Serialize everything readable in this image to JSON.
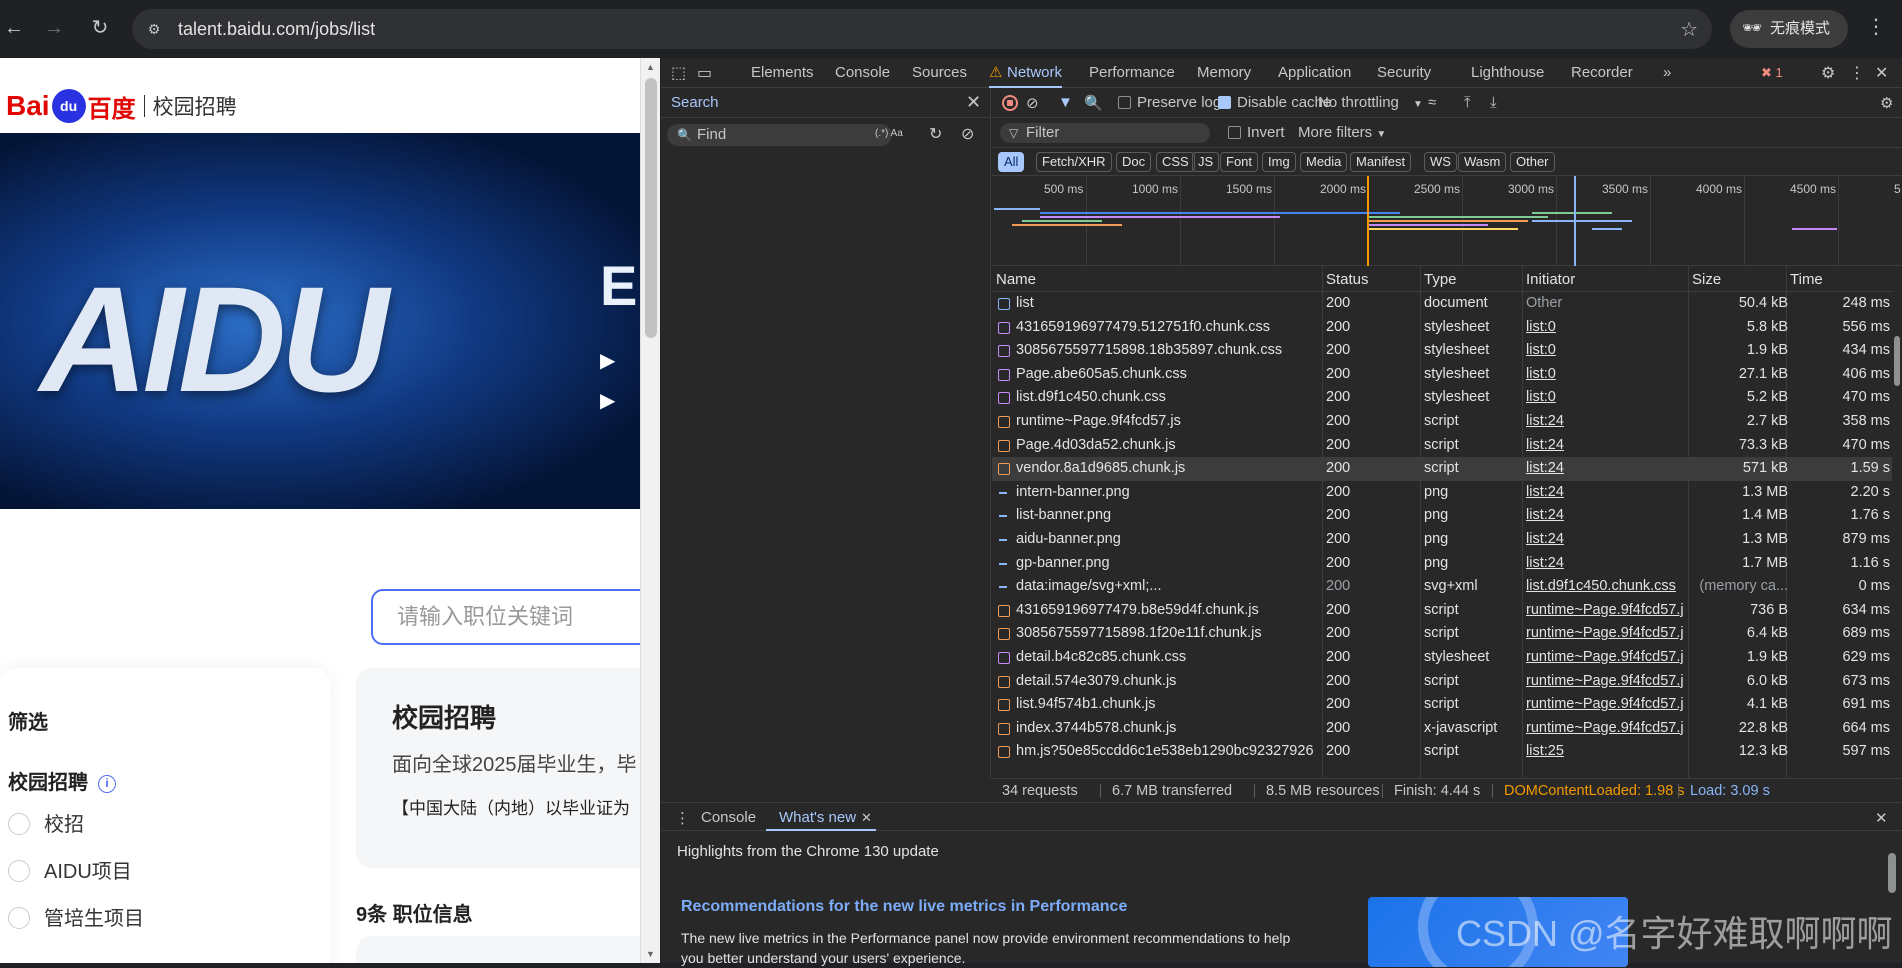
{
  "browser": {
    "url": "talent.baidu.com/jobs/list",
    "incognito_label": "无痕模式"
  },
  "page": {
    "logo": {
      "bai": "Bai",
      "du": "du",
      "cn": "百度",
      "sub": "校园招聘"
    },
    "banner": {
      "text": "AIDU",
      "side": "E"
    },
    "search_placeholder": "请输入职位关键词",
    "filter": {
      "title": "筛选",
      "section": "校园招聘",
      "options": [
        "校招",
        "AIDU项目",
        "管培生项目"
      ]
    },
    "main": {
      "title": "校园招聘",
      "desc": "面向全球2025届毕业生，毕",
      "note": "【中国大陆（内地）以毕业证为"
    },
    "count": "9条 职位信息"
  },
  "devtools": {
    "tabs": [
      "Elements",
      "Console",
      "Sources",
      "Network",
      "Performance",
      "Memory",
      "Application",
      "Security",
      "Lighthouse",
      "Recorder"
    ],
    "active_tab": "Network",
    "error_count": "1",
    "search": {
      "label": "Search",
      "find_placeholder": "Find",
      "opts": "(.*)  Aa"
    },
    "toolbar": {
      "preserve_log": "Preserve log",
      "disable_cache": "Disable cache",
      "throttling": "No throttling"
    },
    "filter": {
      "placeholder": "Filter",
      "invert": "Invert",
      "more_filters": "More filters"
    },
    "type_filters": [
      "All",
      "Fetch/XHR",
      "Doc",
      "CSS",
      "JS",
      "Font",
      "Img",
      "Media",
      "Manifest",
      "WS",
      "Wasm",
      "Other"
    ],
    "timeline_ticks": [
      "500 ms",
      "1000 ms",
      "1500 ms",
      "2000 ms",
      "2500 ms",
      "3000 ms",
      "3500 ms",
      "4000 ms",
      "4500 ms",
      "5"
    ],
    "columns": [
      "Name",
      "Status",
      "Type",
      "Initiator",
      "Size",
      "Time"
    ],
    "requests": [
      {
        "name": "list",
        "status": "200",
        "type": "document",
        "initiator": "Other",
        "size": "50.4 kB",
        "time": "248 ms",
        "kind": "doc"
      },
      {
        "name": "431659196977479.512751f0.chunk.css",
        "status": "200",
        "type": "stylesheet",
        "initiator": "list:0",
        "size": "5.8 kB",
        "time": "556 ms",
        "kind": "css"
      },
      {
        "name": "3085675597715898.18b35897.chunk.css",
        "status": "200",
        "type": "stylesheet",
        "initiator": "list:0",
        "size": "1.9 kB",
        "time": "434 ms",
        "kind": "css"
      },
      {
        "name": "Page.abe605a5.chunk.css",
        "status": "200",
        "type": "stylesheet",
        "initiator": "list:0",
        "size": "27.1 kB",
        "time": "406 ms",
        "kind": "css"
      },
      {
        "name": "list.d9f1c450.chunk.css",
        "status": "200",
        "type": "stylesheet",
        "initiator": "list:0",
        "size": "5.2 kB",
        "time": "470 ms",
        "kind": "css"
      },
      {
        "name": "runtime~Page.9f4fcd57.js",
        "status": "200",
        "type": "script",
        "initiator": "list:24",
        "size": "2.7 kB",
        "time": "358 ms",
        "kind": "js"
      },
      {
        "name": "Page.4d03da52.chunk.js",
        "status": "200",
        "type": "script",
        "initiator": "list:24",
        "size": "73.3 kB",
        "time": "470 ms",
        "kind": "js"
      },
      {
        "name": "vendor.8a1d9685.chunk.js",
        "status": "200",
        "type": "script",
        "initiator": "list:24",
        "size": "571 kB",
        "time": "1.59 s",
        "kind": "js"
      },
      {
        "name": "intern-banner.png",
        "status": "200",
        "type": "png",
        "initiator": "list:24",
        "size": "1.3 MB",
        "time": "2.20 s",
        "kind": "img"
      },
      {
        "name": "list-banner.png",
        "status": "200",
        "type": "png",
        "initiator": "list:24",
        "size": "1.4 MB",
        "time": "1.76 s",
        "kind": "img"
      },
      {
        "name": "aidu-banner.png",
        "status": "200",
        "type": "png",
        "initiator": "list:24",
        "size": "1.3 MB",
        "time": "879 ms",
        "kind": "img"
      },
      {
        "name": "gp-banner.png",
        "status": "200",
        "type": "png",
        "initiator": "list:24",
        "size": "1.7 MB",
        "time": "1.16 s",
        "kind": "img"
      },
      {
        "name": "data:image/svg+xml;...",
        "status": "200",
        "type": "svg+xml",
        "initiator": "list.d9f1c450.chunk.css",
        "size": "(memory ca...",
        "time": "0 ms",
        "kind": "img"
      },
      {
        "name": "431659196977479.b8e59d4f.chunk.js",
        "status": "200",
        "type": "script",
        "initiator": "runtime~Page.9f4fcd57.j",
        "size": "736 B",
        "time": "634 ms",
        "kind": "js"
      },
      {
        "name": "3085675597715898.1f20e11f.chunk.js",
        "status": "200",
        "type": "script",
        "initiator": "runtime~Page.9f4fcd57.j",
        "size": "6.4 kB",
        "time": "689 ms",
        "kind": "js"
      },
      {
        "name": "detail.b4c82c85.chunk.css",
        "status": "200",
        "type": "stylesheet",
        "initiator": "runtime~Page.9f4fcd57.j",
        "size": "1.9 kB",
        "time": "629 ms",
        "kind": "css"
      },
      {
        "name": "detail.574e3079.chunk.js",
        "status": "200",
        "type": "script",
        "initiator": "runtime~Page.9f4fcd57.j",
        "size": "6.0 kB",
        "time": "673 ms",
        "kind": "js"
      },
      {
        "name": "list.94f574b1.chunk.js",
        "status": "200",
        "type": "script",
        "initiator": "runtime~Page.9f4fcd57.j",
        "size": "4.1 kB",
        "time": "691 ms",
        "kind": "js"
      },
      {
        "name": "index.3744b578.chunk.js",
        "status": "200",
        "type": "x-javascript",
        "initiator": "runtime~Page.9f4fcd57.j",
        "size": "22.8 kB",
        "time": "664 ms",
        "kind": "js"
      },
      {
        "name": "hm.js?50e85ccdd6c1e538eb1290bc92327926",
        "status": "200",
        "type": "script",
        "initiator": "list:25",
        "size": "12.3 kB",
        "time": "597 ms",
        "kind": "js"
      }
    ],
    "summary": {
      "requests": "34 requests",
      "transferred": "6.7 MB transferred",
      "resources": "8.5 MB resources",
      "finish": "Finish: 4.44 s",
      "dcl": "DOMContentLoaded: 1.98 s",
      "load": "Load: 3.09 s"
    },
    "drawer": {
      "tabs": [
        "Console",
        "What's new"
      ],
      "headline": "Highlights from the Chrome 130 update",
      "title": "Recommendations for the new live metrics in Performance",
      "text": "The new live metrics in the Performance panel now provide environment recommendations to help you better understand your users' experience."
    }
  },
  "watermark": "CSDN @名字好难取啊啊啊",
  "colors": {
    "dcl": "#f29900",
    "load": "#8ab4f8",
    "accent": "#a8c7fa"
  }
}
